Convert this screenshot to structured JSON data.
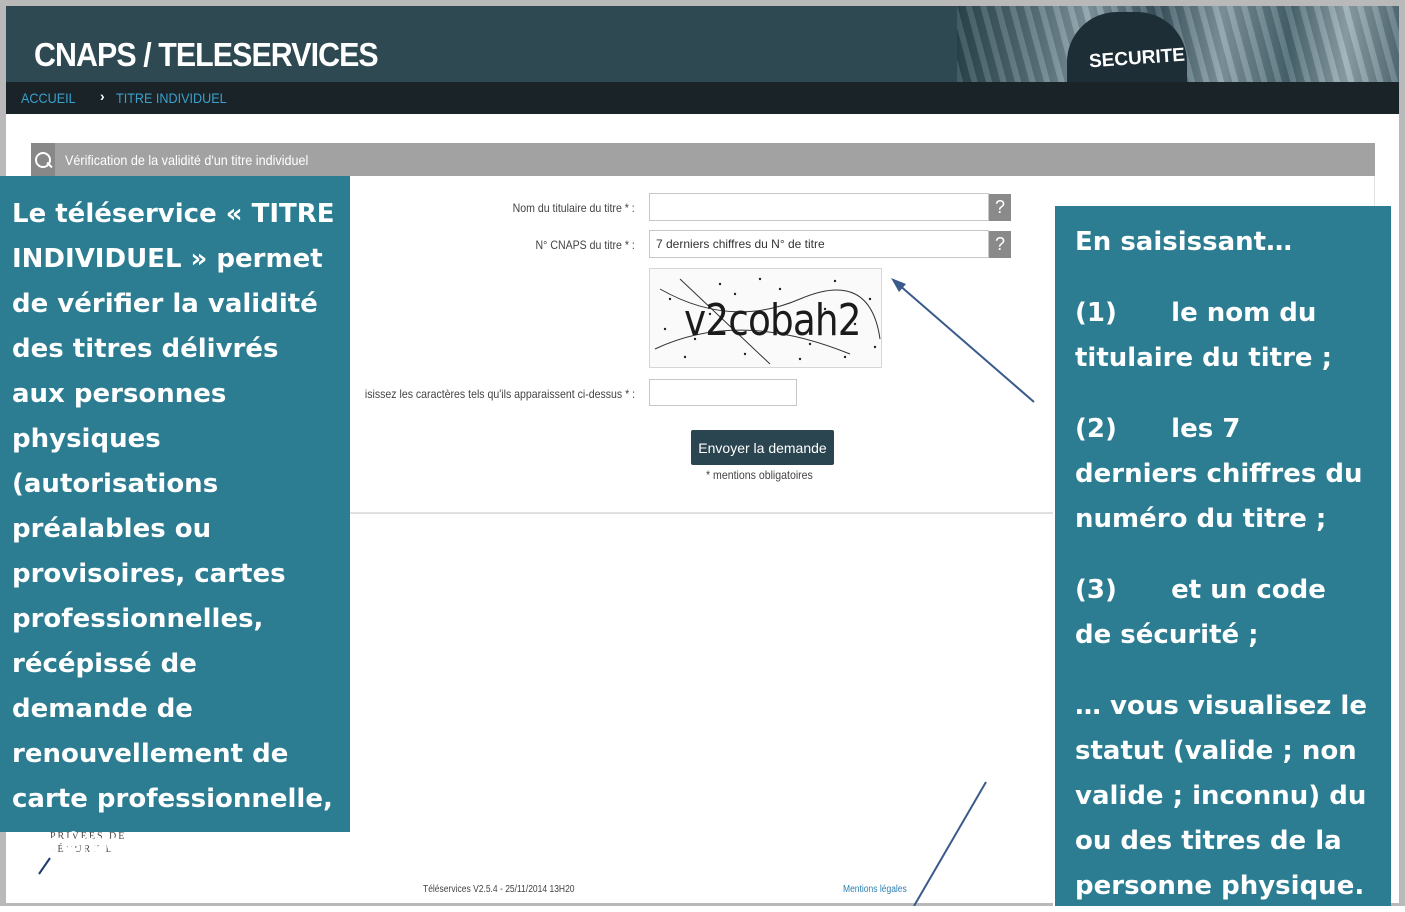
{
  "header": {
    "title": "CNAPS / TELESERVICES",
    "banner_label": "SECURITE"
  },
  "breadcrumb": {
    "home": "ACCUEIL",
    "separator": "›",
    "current": "TITRE INDIVIDUEL"
  },
  "panel": {
    "title": "Vérification de la validité d'un titre individuel"
  },
  "form": {
    "name_label": "Nom du titulaire du titre * :",
    "name_value": "",
    "number_label": "N° CNAPS du titre * :",
    "number_value": "7 derniers chiffres du N° de titre",
    "help_glyph": "?",
    "captcha_text": "v2cobah2",
    "captcha_label": "isissez les caractères tels qu'ils apparaissent ci-dessus * :",
    "captcha_value": "",
    "submit_label": "Envoyer la demande",
    "mandatory_note": "* mentions obligatoires"
  },
  "logo": {
    "line1": "PRIVÉES DE",
    "line2": "SÉCURITÉ"
  },
  "footer": {
    "version": "Téléservices V2.5.4 - 25/11/2014 13H20",
    "legal_link": "Mentions légales"
  },
  "callouts": {
    "left": "Le téléservice « TITRE INDIVIDUEL » permet de vérifier la validité des titres délivrés aux personnes physiques (autorisations préalables ou provisoires, cartes professionnelles, récépissé de demande de renouvellement de carte professionnelle, agréments dirigeants et associés).",
    "right_intro": "En saisissant…",
    "right_item1": "(1)      le nom du titulaire du titre ;",
    "right_item2": "(2)      les 7 derniers chiffres du numéro du titre ;",
    "right_item3": "(3)      et un code de sécurité ;",
    "right_outro": "… vous visualisez le statut (valide ; non valide ; inconnu) du ou des titres de la personne physique."
  },
  "colors": {
    "header_bg": "#2e4952",
    "nav_bg": "#1a2327",
    "crumb_link": "#3aa0cc",
    "callout_bg": "#2c7d92",
    "button_bg": "#2a4550",
    "arrow": "#3a5a8c"
  }
}
